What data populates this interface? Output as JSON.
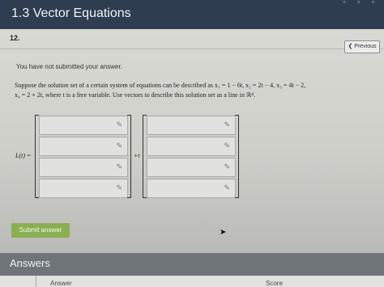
{
  "header": {
    "title": "1.3 Vector Equations"
  },
  "question": {
    "number": "12.",
    "previous_label": "❮ Previous",
    "notice": "You have not submitted your answer.",
    "text_line1": "Suppose the solution set of a certain system of equations can be described as x₁ = 1 − 6t, x₂ = 2t − 4, x₃ = 4t − 2,",
    "text_line2": "x₄ = 2 + 2t, where t is a free variable. Use vectors to describe this solution set as a line in ℝ⁴.",
    "lhs_label": "L(t) =",
    "plus_t": "+t"
  },
  "vectors": {
    "left_cells": [
      "",
      "",
      "",
      ""
    ],
    "right_cells": [
      "",
      "",
      "",
      ""
    ]
  },
  "icons": {
    "pencil": "✎"
  },
  "actions": {
    "submit_label": "Submit answer"
  },
  "answers": {
    "title": "Answers",
    "col_answer": "Answer",
    "col_score": "Score"
  },
  "colors": {
    "header_bg": "#2e3d50",
    "submit_bg": "#8aae52"
  }
}
